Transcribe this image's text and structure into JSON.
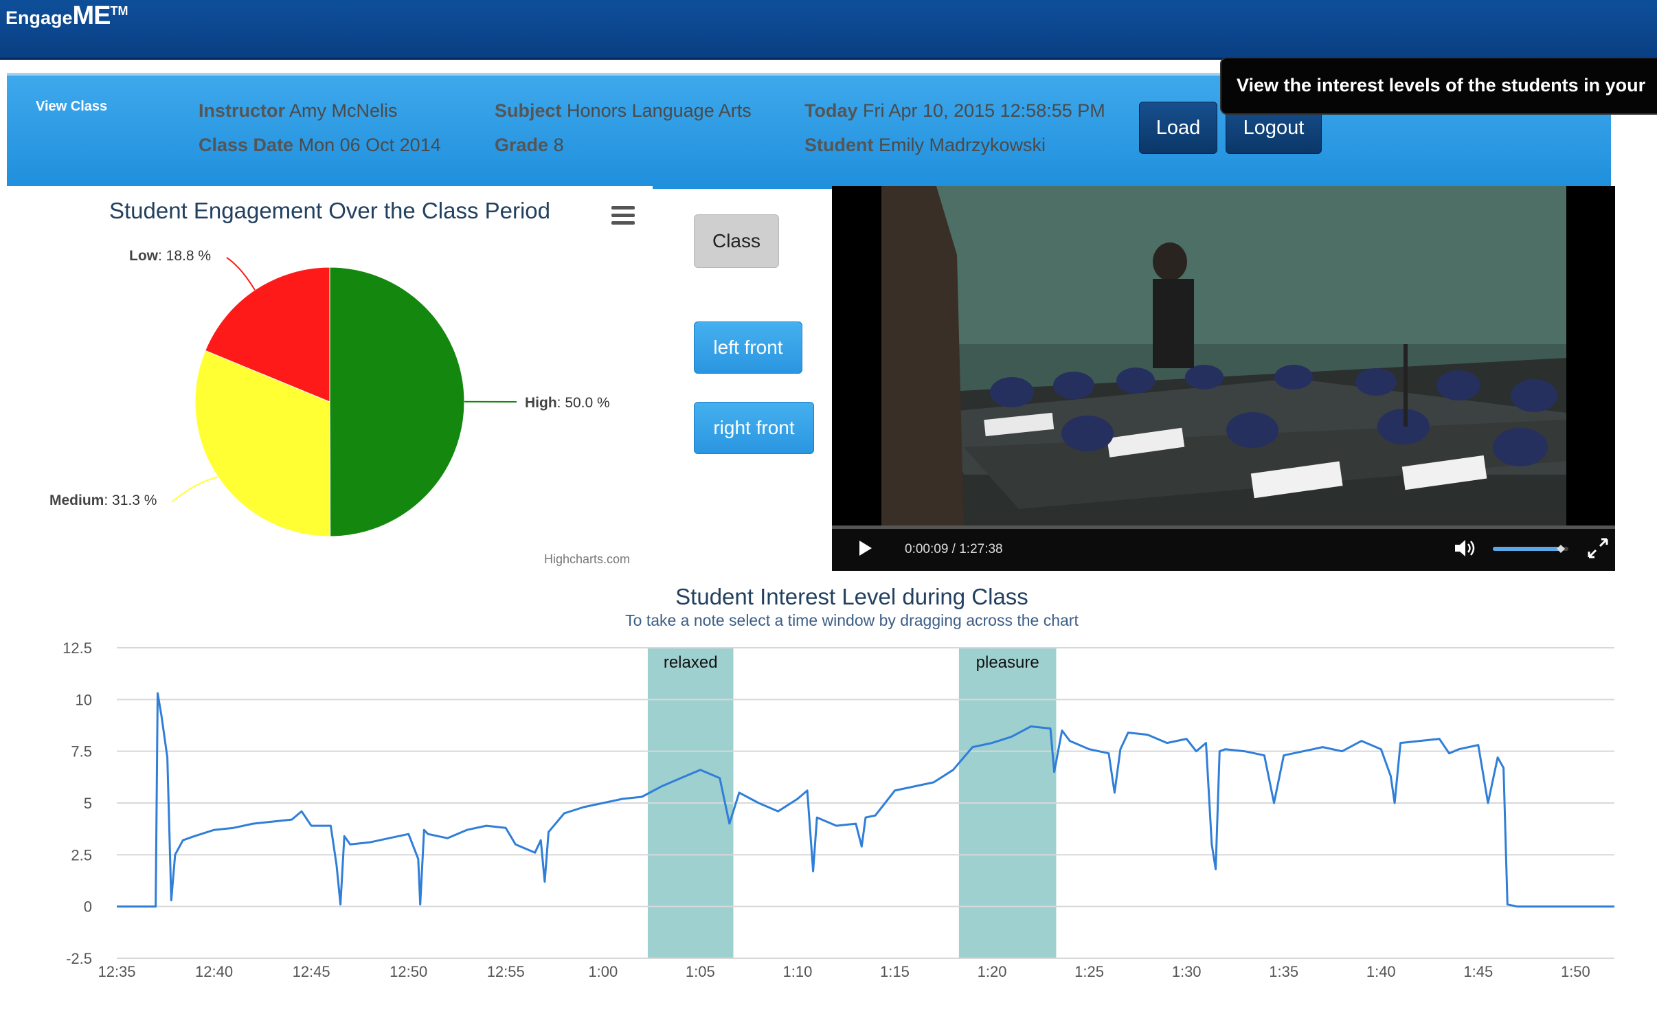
{
  "app": {
    "logo_a": "Engage",
    "logo_b": "ME",
    "logo_tm": "TM"
  },
  "classbar": {
    "view_class": "View Class",
    "instructor_label": "Instructor",
    "instructor": "Amy McNelis",
    "class_date_label": "Class Date",
    "class_date": "Mon 06 Oct 2014",
    "subject_label": "Subject",
    "subject": "Honors Language Arts",
    "grade_label": "Grade",
    "grade": "8",
    "today_label": "Today",
    "today": "Fri Apr 10, 2015 12:58:55 PM",
    "student_label": "Student",
    "student": "Emily Madrzykowski",
    "load": "Load",
    "logout": "Logout"
  },
  "tooltip": "View the interest levels of the students in your",
  "buttons": {
    "class": "Class",
    "left_front": "left front",
    "right_front": "right front"
  },
  "video": {
    "time": "0:00:09 / 1:27:38",
    "volume_level": 0.9
  },
  "colors": {
    "high": "#14870f",
    "medium": "#ffff33",
    "low": "#ff1a1a",
    "line": "#2f7ed8",
    "band": "#9fd0d0"
  },
  "chart_data": [
    {
      "type": "pie",
      "title": "Student Engagement Over the Class Period",
      "credit": "Highcharts.com",
      "slices": [
        {
          "name": "High",
          "value": 50.0,
          "label": "50.0 %",
          "color": "#14870f"
        },
        {
          "name": "Medium",
          "value": 31.3,
          "label": "31.3 %",
          "color": "#ffff33"
        },
        {
          "name": "Low",
          "value": 18.8,
          "label": "18.8 %",
          "color": "#ff1a1a"
        }
      ]
    },
    {
      "type": "line",
      "title": "Student Interest Level during Class",
      "subtitle": "To take a note select a time window by dragging across the chart",
      "ylim": [
        -2.5,
        12.5
      ],
      "yticks": [
        "12.5",
        "10",
        "7.5",
        "5",
        "2.5",
        "0",
        "-2.5"
      ],
      "ytick_values": [
        12.5,
        10,
        7.5,
        5,
        2.5,
        0,
        -2.5
      ],
      "xlim_minutes": [
        0,
        77
      ],
      "xticks": [
        "12:35",
        "12:40",
        "12:45",
        "12:50",
        "12:55",
        "1:00",
        "1:05",
        "1:10",
        "1:15",
        "1:20",
        "1:25",
        "1:30",
        "1:35",
        "1:40",
        "1:45",
        "1:50"
      ],
      "grid": true,
      "plot_bands": [
        {
          "label": "relaxed",
          "from_min": 27.3,
          "to_min": 31.7
        },
        {
          "label": "pleasure",
          "from_min": 43.3,
          "to_min": 48.3
        }
      ],
      "series": [
        {
          "points_minutes": [
            [
              0,
              0
            ],
            [
              2,
              0
            ],
            [
              2.1,
              10.3
            ],
            [
              2.3,
              9.2
            ],
            [
              2.6,
              7.2
            ],
            [
              2.8,
              0.3
            ],
            [
              3.0,
              2.5
            ],
            [
              3.4,
              3.2
            ],
            [
              4,
              3.4
            ],
            [
              5,
              3.7
            ],
            [
              6,
              3.8
            ],
            [
              7,
              4.0
            ],
            [
              8,
              4.1
            ],
            [
              9,
              4.2
            ],
            [
              9.5,
              4.6
            ],
            [
              10,
              3.9
            ],
            [
              11,
              3.9
            ],
            [
              11.3,
              2.0
            ],
            [
              11.5,
              0.1
            ],
            [
              11.7,
              3.4
            ],
            [
              12,
              3.0
            ],
            [
              13,
              3.1
            ],
            [
              14,
              3.3
            ],
            [
              15,
              3.5
            ],
            [
              15.5,
              2.3
            ],
            [
              15.6,
              0.1
            ],
            [
              15.8,
              3.7
            ],
            [
              16,
              3.5
            ],
            [
              17,
              3.3
            ],
            [
              18,
              3.7
            ],
            [
              19,
              3.9
            ],
            [
              20,
              3.8
            ],
            [
              20.5,
              3.0
            ],
            [
              21,
              2.8
            ],
            [
              21.5,
              2.6
            ],
            [
              21.8,
              3.2
            ],
            [
              22,
              1.2
            ],
            [
              22.2,
              3.6
            ],
            [
              23,
              4.5
            ],
            [
              24,
              4.8
            ],
            [
              25,
              5.0
            ],
            [
              26,
              5.2
            ],
            [
              27,
              5.3
            ],
            [
              28,
              5.8
            ],
            [
              29,
              6.2
            ],
            [
              30,
              6.6
            ],
            [
              31,
              6.2
            ],
            [
              31.5,
              4.0
            ],
            [
              32,
              5.5
            ],
            [
              33,
              5.0
            ],
            [
              34,
              4.6
            ],
            [
              35,
              5.2
            ],
            [
              35.5,
              5.6
            ],
            [
              35.8,
              1.7
            ],
            [
              36,
              4.3
            ],
            [
              37,
              3.9
            ],
            [
              38,
              4.0
            ],
            [
              38.3,
              2.9
            ],
            [
              38.5,
              4.3
            ],
            [
              39,
              4.4
            ],
            [
              40,
              5.6
            ],
            [
              41,
              5.8
            ],
            [
              42,
              6.0
            ],
            [
              43,
              6.6
            ],
            [
              44,
              7.7
            ],
            [
              45,
              7.9
            ],
            [
              46,
              8.2
            ],
            [
              47,
              8.7
            ],
            [
              48,
              8.6
            ],
            [
              48.2,
              6.5
            ],
            [
              48.6,
              8.5
            ],
            [
              49,
              8.0
            ],
            [
              50,
              7.6
            ],
            [
              51,
              7.4
            ],
            [
              51.3,
              5.5
            ],
            [
              51.6,
              7.6
            ],
            [
              52,
              8.4
            ],
            [
              53,
              8.3
            ],
            [
              54,
              7.9
            ],
            [
              55,
              8.1
            ],
            [
              55.5,
              7.5
            ],
            [
              56,
              7.9
            ],
            [
              56.3,
              3.0
            ],
            [
              56.5,
              1.8
            ],
            [
              56.7,
              7.5
            ],
            [
              57,
              7.6
            ],
            [
              58,
              7.5
            ],
            [
              59,
              7.3
            ],
            [
              59.5,
              5.0
            ],
            [
              60,
              7.3
            ],
            [
              61,
              7.5
            ],
            [
              62,
              7.7
            ],
            [
              63,
              7.5
            ],
            [
              64,
              8.0
            ],
            [
              65,
              7.6
            ],
            [
              65.5,
              6.3
            ],
            [
              65.7,
              5.0
            ],
            [
              66,
              7.9
            ],
            [
              67,
              8.0
            ],
            [
              68,
              8.1
            ],
            [
              68.5,
              7.4
            ],
            [
              69,
              7.6
            ],
            [
              70,
              7.8
            ],
            [
              70.5,
              5.0
            ],
            [
              71,
              7.2
            ],
            [
              71.3,
              6.7
            ],
            [
              71.5,
              0.1
            ],
            [
              72,
              0
            ],
            [
              77,
              0
            ]
          ],
          "color": "#2f7ed8"
        }
      ]
    }
  ]
}
